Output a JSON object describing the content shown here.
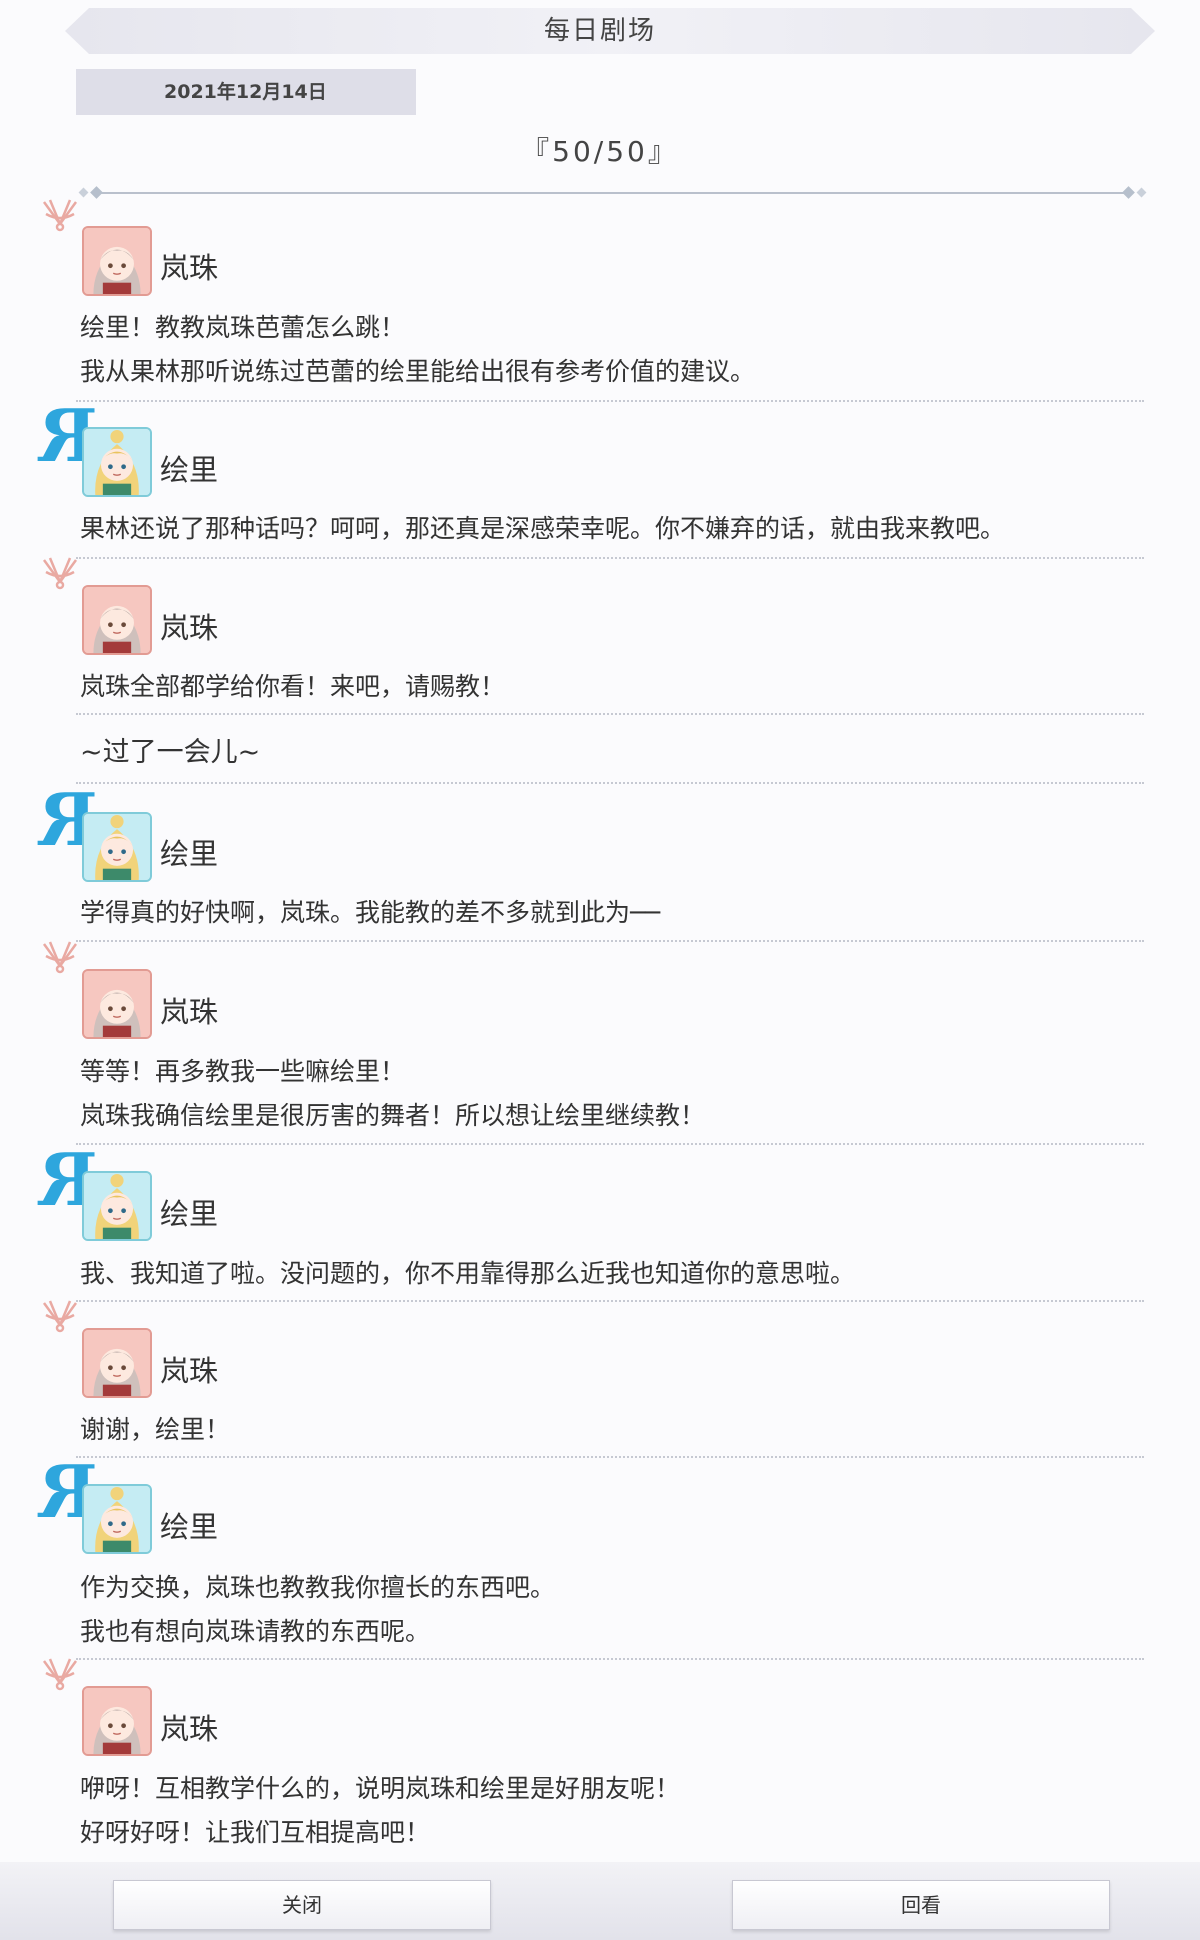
{
  "header": {
    "title": "每日剧场"
  },
  "date": "2021年12月14日",
  "episode_title": "『50/50』",
  "messages": [
    {
      "speaker": "岚珠",
      "lines": [
        "绘里！教教岚珠芭蕾怎么跳！",
        "我从果林那听说练过芭蕾的绘里能给出很有参考价值的建议。"
      ]
    },
    {
      "speaker": "绘里",
      "lines": [
        "果林还说了那种话吗？呵呵，那还真是深感荣幸呢。你不嫌弃的话，就由我来教吧。"
      ]
    },
    {
      "speaker": "岚珠",
      "lines": [
        "岚珠全部都学给你看！来吧，请赐教！"
      ]
    },
    {
      "narration": "~过了一会儿~"
    },
    {
      "speaker": "绘里",
      "lines": [
        "学得真的好快啊，岚珠。我能教的差不多就到此为──"
      ]
    },
    {
      "speaker": "岚珠",
      "lines": [
        "等等！再多教我一些嘛绘里！",
        "岚珠我确信绘里是很厉害的舞者！所以想让绘里继续教！"
      ]
    },
    {
      "speaker": "绘里",
      "lines": [
        "我、我知道了啦。没问题的，你不用靠得那么近我也知道你的意思啦。"
      ]
    },
    {
      "speaker": "岚珠",
      "lines": [
        "谢谢，绘里！"
      ]
    },
    {
      "speaker": "绘里",
      "lines": [
        "作为交换，岚珠也教教我你擅长的东西吧。",
        "我也有想向岚珠请教的东西呢。"
      ]
    },
    {
      "speaker": "岚珠",
      "lines": [
        "咿呀！互相教学什么的，说明岚珠和绘里是好朋友呢！",
        "好呀好呀！让我们互相提高吧！"
      ]
    }
  ],
  "emblems": {
    "r_mark": "R"
  },
  "buttons": {
    "close": "关闭",
    "replay": "回看"
  }
}
